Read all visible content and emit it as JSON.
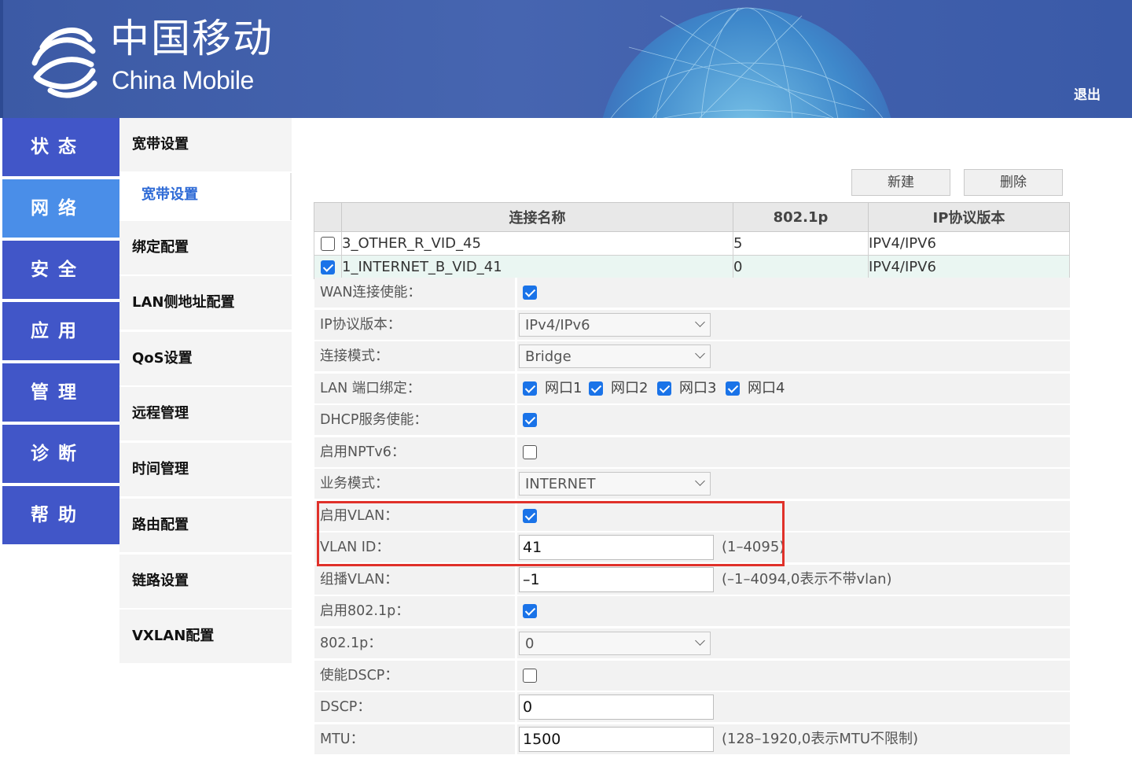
{
  "header": {
    "brand_cn": "中国移动",
    "brand_en": "China Mobile",
    "logout": "退出",
    "colors": {
      "header_bg": "#4262ad",
      "nav_bg": "#4156c8",
      "nav_active": "#4a8ee8",
      "highlight": "#e0312a",
      "checkbox": "#1a73e8"
    }
  },
  "nav": {
    "items": [
      {
        "label": "状态"
      },
      {
        "label": "网络"
      },
      {
        "label": "安全"
      },
      {
        "label": "应用"
      },
      {
        "label": "管理"
      },
      {
        "label": "诊断"
      },
      {
        "label": "帮助"
      }
    ],
    "active": "网络"
  },
  "subnav": {
    "items": [
      {
        "label": "宽带设置"
      },
      {
        "label": "宽带设置"
      },
      {
        "label": "绑定配置"
      },
      {
        "label": "LAN侧地址配置"
      },
      {
        "label": "QoS设置"
      },
      {
        "label": "远程管理"
      },
      {
        "label": "时间管理"
      },
      {
        "label": "路由配置"
      },
      {
        "label": "链路设置"
      },
      {
        "label": "VXLAN配置"
      }
    ]
  },
  "toolbar": {
    "new_label": "新建",
    "delete_label": "删除"
  },
  "table": {
    "headers": [
      "连接名称",
      "802.1p",
      "IP协议版本"
    ],
    "rows": [
      {
        "checked": false,
        "name": "3_OTHER_R_VID_45",
        "p8021": "5",
        "ipver": "IPV4/IPV6"
      },
      {
        "checked": true,
        "name": "1_INTERNET_B_VID_41",
        "p8021": "0",
        "ipver": "IPV4/IPV6"
      }
    ]
  },
  "form": {
    "wan_enable": {
      "label": "WAN连接使能：",
      "checked": true
    },
    "ip_version": {
      "label": "IP协议版本：",
      "value": "IPv4/IPv6"
    },
    "conn_mode": {
      "label": "连接模式：",
      "value": "Bridge"
    },
    "lan_bind": {
      "label": "LAN 端口绑定：",
      "ports": [
        {
          "label": "网口1",
          "checked": true
        },
        {
          "label": "网口2",
          "checked": true
        },
        {
          "label": "网口3",
          "checked": true
        },
        {
          "label": "网口4",
          "checked": true
        }
      ]
    },
    "dhcp_enable": {
      "label": "DHCP服务使能：",
      "checked": true
    },
    "nptv6": {
      "label": "启用NPTv6：",
      "checked": false
    },
    "service_mode": {
      "label": "业务模式：",
      "value": "INTERNET"
    },
    "vlan_enable": {
      "label": "启用VLAN：",
      "checked": true
    },
    "vlan_id": {
      "label": "VLAN ID：",
      "value": "41",
      "hint": "(1–4095)"
    },
    "multicast_vlan": {
      "label": "组播VLAN：",
      "value": "–1",
      "hint": "(–1–4094,0表示不带vlan)"
    },
    "enable_8021p": {
      "label": "启用802.1p：",
      "checked": true
    },
    "p8021": {
      "label": "802.1p：",
      "value": "0"
    },
    "dscp_enable": {
      "label": "使能DSCP：",
      "checked": false
    },
    "dscp": {
      "label": "DSCP：",
      "value": "0"
    },
    "mtu": {
      "label": "MTU：",
      "value": "1500",
      "hint": "(128–1920,0表示MTU不限制)"
    }
  }
}
